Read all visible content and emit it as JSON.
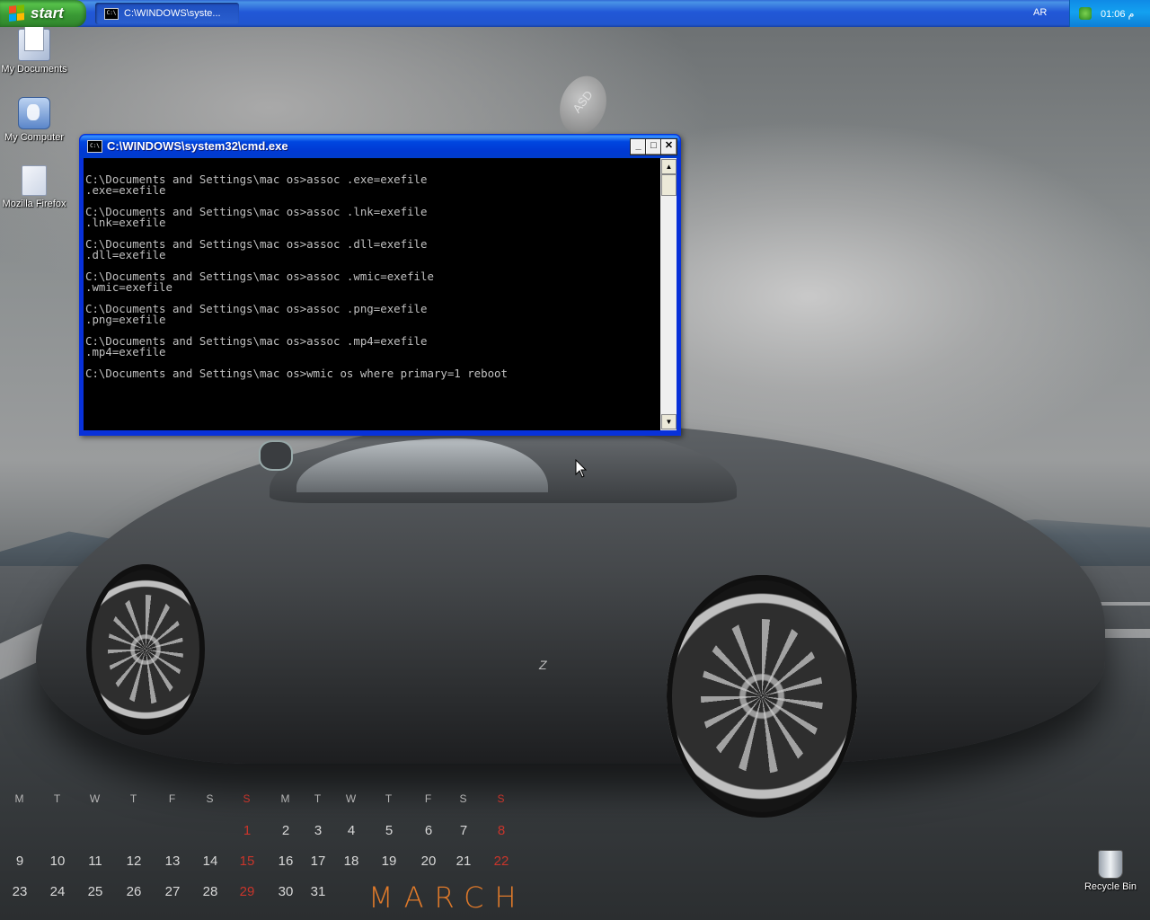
{
  "taskbar": {
    "start_label": "start",
    "task_button_label": "C:\\WINDOWS\\syste...",
    "language": "AR",
    "clock": "01:06 م"
  },
  "desktop_icons": [
    {
      "label": "My Documents",
      "icon": "my-documents-icon"
    },
    {
      "label": "My Computer",
      "icon": "my-computer-icon"
    },
    {
      "label": "Mozilla Firefox",
      "icon": "document-icon"
    },
    {
      "label": "Recycle Bin",
      "icon": "recycle-bin-icon"
    }
  ],
  "cmd_window": {
    "title": "C:\\WINDOWS\\system32\\cmd.exe",
    "icon_text": "C:\\",
    "lines": [
      "C:\\Documents and Settings\\mac os>assoc .exe=exefile",
      ".exe=exefile",
      "",
      "C:\\Documents and Settings\\mac os>assoc .lnk=exefile",
      ".lnk=exefile",
      "",
      "C:\\Documents and Settings\\mac os>assoc .dll=exefile",
      ".dll=exefile",
      "",
      "C:\\Documents and Settings\\mac os>assoc .wmic=exefile",
      ".wmic=exefile",
      "",
      "C:\\Documents and Settings\\mac os>assoc .png=exefile",
      ".png=exefile",
      "",
      "C:\\Documents and Settings\\mac os>assoc .mp4=exefile",
      ".mp4=exefile",
      "",
      "C:\\Documents and Settings\\mac os>wmic os where primary=1 reboot"
    ],
    "minimize_glyph": "_",
    "maximize_glyph": "□",
    "close_glyph": "✕"
  },
  "wallpaper": {
    "badge_text": "ASD",
    "car_badge": "Z",
    "calendar": {
      "weekdays": [
        "M",
        "T",
        "W",
        "T",
        "F",
        "S",
        "S",
        "M",
        "T",
        "W",
        "T",
        "F",
        "S",
        "S"
      ],
      "weeks": [
        [
          "",
          "",
          "",
          "",
          "",
          "",
          "1",
          "2",
          "3",
          "4",
          "5",
          "6",
          "7",
          "8"
        ],
        [
          "9",
          "10",
          "11",
          "12",
          "13",
          "14",
          "15",
          "16",
          "17",
          "18",
          "19",
          "20",
          "21",
          "22"
        ],
        [
          "23",
          "24",
          "25",
          "26",
          "27",
          "28",
          "29",
          "30",
          "31",
          "",
          "",
          "",
          "",
          ""
        ]
      ],
      "month": "MARCH",
      "sunday_color": "#c9352b"
    }
  }
}
